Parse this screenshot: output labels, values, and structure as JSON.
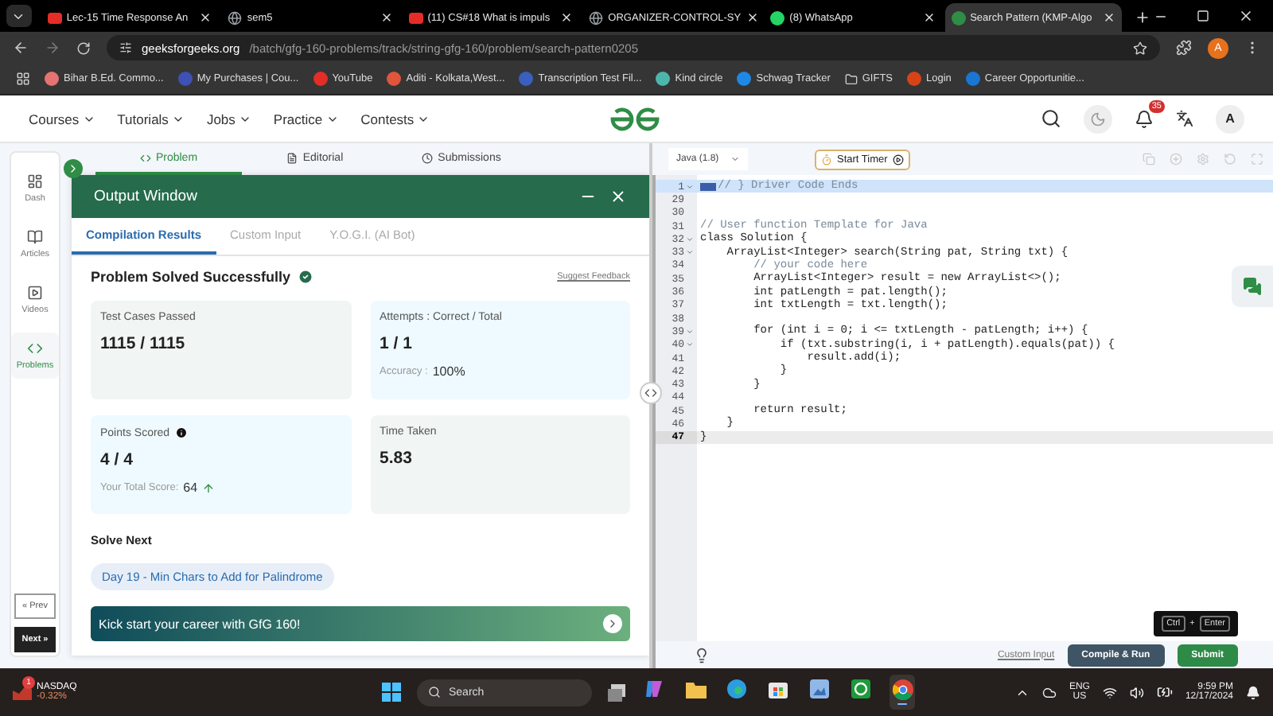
{
  "browser": {
    "tabs": [
      {
        "title": "Lec-15 Time Response An",
        "kind": "youtube",
        "selected": false
      },
      {
        "title": "sem5",
        "kind": "globe",
        "selected": false
      },
      {
        "title": "(11) CS#18 What is impuls",
        "kind": "youtube",
        "selected": false
      },
      {
        "title": "ORGANIZER-CONTROL-SY",
        "kind": "globe",
        "selected": false
      },
      {
        "title": "(8) WhatsApp",
        "kind": "whatsapp",
        "selected": false
      },
      {
        "title": "Search Pattern (KMP-Algo",
        "kind": "gfg",
        "selected": true
      }
    ],
    "url": {
      "domain": "geeksforgeeks.org",
      "path": "/batch/gfg-160-problems/track/string-gfg-160/problem/search-pattern0205"
    },
    "profile": "A",
    "bookmarks": [
      {
        "label": "Bihar B.Ed. Commo...",
        "kind": "site",
        "color": "#e57373"
      },
      {
        "label": "My Purchases | Cou...",
        "kind": "site",
        "color": "#3f51b5"
      },
      {
        "label": "YouTube",
        "kind": "site",
        "color": "#e52d27"
      },
      {
        "label": "Aditi - Kolkata,West...",
        "kind": "site",
        "color": "#e0553c"
      },
      {
        "label": "Transcription Test Fil...",
        "kind": "site",
        "color": "#3b5fbf"
      },
      {
        "label": "Kind circle",
        "kind": "site",
        "color": "#4db6ac"
      },
      {
        "label": "Schwag Tracker",
        "kind": "site",
        "color": "#1e88e5"
      },
      {
        "label": "GIFTS",
        "kind": "folder",
        "color": "#cccccc"
      },
      {
        "label": "Login",
        "kind": "site",
        "color": "#d84315"
      },
      {
        "label": "Career Opportunitie...",
        "kind": "site",
        "color": "#1976d2"
      }
    ]
  },
  "site_nav": {
    "menus": [
      "Courses",
      "Tutorials",
      "Jobs",
      "Practice",
      "Contests"
    ],
    "notifications": "35",
    "avatar": "A"
  },
  "sidebar": {
    "items": [
      {
        "label": "Dash",
        "selected": false
      },
      {
        "label": "Articles",
        "selected": false
      },
      {
        "label": "Videos",
        "selected": false
      },
      {
        "label": "Problems",
        "selected": true
      }
    ],
    "prev": "« Prev",
    "next": "Next »"
  },
  "problem_tabs": [
    {
      "label": "Problem",
      "selected": true
    },
    {
      "label": "Editorial",
      "selected": false
    },
    {
      "label": "Submissions",
      "selected": false
    }
  ],
  "output_window": {
    "title": "Output Window",
    "tabs": [
      {
        "label": "Compilation Results",
        "selected": true
      },
      {
        "label": "Custom Input",
        "selected": false
      },
      {
        "label": "Y.O.G.I. (AI Bot)",
        "selected": false
      }
    ],
    "status": "Problem Solved Successfully",
    "feedback": "Suggest Feedback",
    "cards": [
      {
        "label": "Test Cases Passed",
        "value": "1115 / 1115",
        "kind": "neutral"
      },
      {
        "label": "Attempts : Correct / Total",
        "value": "1 / 1",
        "kind": "accent",
        "sub_label": "Accuracy :",
        "sub_value": "100%"
      },
      {
        "label": "Points Scored",
        "value": "4 / 4",
        "kind": "accent",
        "info": true,
        "sub_label": "Your Total Score:",
        "sub_value": "64",
        "rising": true
      },
      {
        "label": "Time Taken",
        "value": "5.83",
        "kind": "neutral"
      }
    ],
    "solve_next": {
      "heading": "Solve Next",
      "problem": "Day 19 - Min Chars to Add for Palindrome"
    },
    "banner": "Kick start your career with GfG 160!"
  },
  "editor": {
    "language": "Java (1.8)",
    "timer": "Start Timer",
    "lines": [
      {
        "number": "1",
        "text": "// } Driver Code Ends",
        "kind": "comment",
        "fold": true,
        "collapsed": true,
        "selected": true,
        "current": false
      },
      {
        "number": "29",
        "fold": false,
        "collapsed": false,
        "selected": false,
        "current": false
      },
      {
        "number": "30",
        "fold": false,
        "collapsed": false,
        "selected": false,
        "current": false
      },
      {
        "number": "31",
        "text": "// User function Template for Java",
        "kind": "comment",
        "fold": false,
        "collapsed": false,
        "selected": false,
        "current": false
      },
      {
        "number": "32",
        "text": "class Solution {",
        "kind": "code",
        "fold": true,
        "collapsed": false,
        "selected": false,
        "current": false
      },
      {
        "number": "33",
        "text": "    ArrayList<Integer> search(String pat, String txt) {",
        "kind": "code",
        "fold": true,
        "collapsed": false,
        "selected": false,
        "current": false
      },
      {
        "number": "34",
        "text": "        // your code here",
        "kind": "comment",
        "fold": false,
        "collapsed": false,
        "selected": false,
        "current": false
      },
      {
        "number": "35",
        "text": "        ArrayList<Integer> result = new ArrayList<>();",
        "kind": "code",
        "fold": false,
        "collapsed": false,
        "selected": false,
        "current": false
      },
      {
        "number": "36",
        "text": "        int patLength = pat.length();",
        "kind": "code",
        "fold": false,
        "collapsed": false,
        "selected": false,
        "current": false
      },
      {
        "number": "37",
        "text": "        int txtLength = txt.length();",
        "kind": "code",
        "fold": false,
        "collapsed": false,
        "selected": false,
        "current": false
      },
      {
        "number": "38",
        "fold": false,
        "collapsed": false,
        "selected": false,
        "current": false
      },
      {
        "number": "39",
        "text": "        for (int i = 0; i <= txtLength - patLength; i++) {",
        "kind": "code",
        "fold": true,
        "collapsed": false,
        "selected": false,
        "current": false
      },
      {
        "number": "40",
        "text": "            if (txt.substring(i, i + patLength).equals(pat)) {",
        "kind": "code",
        "fold": true,
        "collapsed": false,
        "selected": false,
        "current": false
      },
      {
        "number": "41",
        "text": "                result.add(i);",
        "kind": "code",
        "fold": false,
        "collapsed": false,
        "selected": false,
        "current": false
      },
      {
        "number": "42",
        "text": "            }",
        "kind": "code",
        "fold": false,
        "collapsed": false,
        "selected": false,
        "current": false
      },
      {
        "number": "43",
        "text": "        }",
        "kind": "code",
        "fold": false,
        "collapsed": false,
        "selected": false,
        "current": false
      },
      {
        "number": "44",
        "fold": false,
        "collapsed": false,
        "selected": false,
        "current": false
      },
      {
        "number": "45",
        "text": "        return result;",
        "kind": "code",
        "fold": false,
        "collapsed": false,
        "selected": false,
        "current": false
      },
      {
        "number": "46",
        "text": "    }",
        "kind": "code",
        "fold": false,
        "collapsed": false,
        "selected": false,
        "current": false
      },
      {
        "number": "47",
        "text": "}",
        "kind": "code",
        "fold": false,
        "collapsed": false,
        "selected": false,
        "current": true
      }
    ],
    "custom_input": "Custom Input",
    "compile": "Compile & Run",
    "submit": "Submit",
    "shortcut": {
      "keys": [
        "Ctrl",
        "Enter"
      ],
      "joiner": "+"
    }
  },
  "taskbar": {
    "stock": {
      "badge": "1",
      "name": "NASDAQ",
      "change": "-0.32%"
    },
    "search": "Search",
    "apps": [
      {
        "kind": "copilot",
        "selected": false
      },
      {
        "kind": "explorer",
        "selected": false
      },
      {
        "kind": "edge",
        "selected": false
      },
      {
        "kind": "store",
        "selected": false
      },
      {
        "kind": "photos",
        "selected": false
      },
      {
        "kind": "xbox",
        "selected": false
      },
      {
        "kind": "chrome",
        "selected": true
      }
    ],
    "language": "ENG",
    "region": "US",
    "time": "9:59 PM",
    "date": "12/17/2024"
  }
}
